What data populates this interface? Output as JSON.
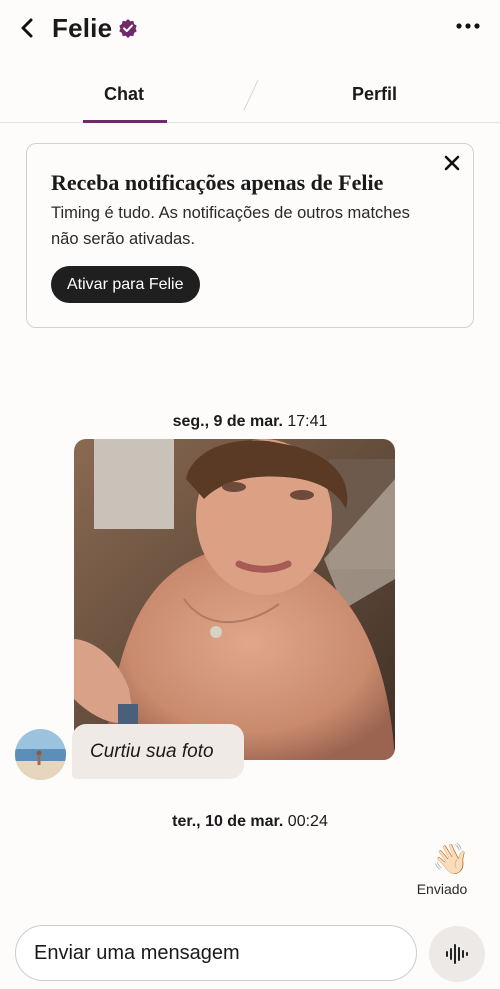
{
  "header": {
    "name": "Felie",
    "back_icon": "chevron-left-icon",
    "verified_icon": "verified-badge-icon",
    "more_icon": "more-horizontal-icon",
    "accent_color": "#6e2a6a"
  },
  "tabs": [
    {
      "label": "Chat",
      "active": true
    },
    {
      "label": "Perfil",
      "active": false
    }
  ],
  "notification_card": {
    "title": "Receba notificações apenas de Felie",
    "body": "Timing é tudo. As notificações de outros matches não serão ativadas.",
    "button_label": "Ativar para Felie",
    "close_icon": "close-icon"
  },
  "messages": {
    "date1": {
      "day": "seg., 9 de mar.",
      "time": "17:41"
    },
    "photo_icon": "shirtless-selfie-photo",
    "liked_text": "Curtiu sua foto",
    "avatar_icon": "beach-avatar",
    "date2": {
      "day": "ter., 10 de mar.",
      "time": "00:24"
    },
    "sent_emoji": "👋🏻",
    "sent_status": "Enviado"
  },
  "composer": {
    "placeholder": "Enviar uma mensagem",
    "voice_icon": "voice-waveform-icon"
  }
}
